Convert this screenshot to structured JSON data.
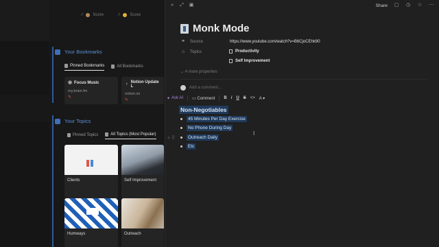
{
  "background": {
    "score_columns": [
      {
        "hash": "#",
        "label": "Score",
        "dot_color": "#b08a5a"
      },
      {
        "hash": "#",
        "label": "Score",
        "dot_color": "#e0b03a"
      }
    ],
    "bookmarks": {
      "title": "Your Bookmarks",
      "tabs": [
        {
          "label": "Pinned Bookmarks",
          "active": true
        },
        {
          "label": "All Bookmarks",
          "active": false
        }
      ],
      "cards": [
        {
          "title": "Focus Music",
          "subtitle": "my.brain.fm",
          "pin": "✎"
        },
        {
          "title": "Notion Update L",
          "subtitle": "notion.so",
          "pin": "✎"
        }
      ]
    },
    "topics": {
      "title": "Your Topics",
      "tabs": [
        {
          "label": "Pinned Topics",
          "active": false
        },
        {
          "label": "All Topics (Most Popular)",
          "active": true
        }
      ],
      "cards": [
        {
          "label": "Clients"
        },
        {
          "label": "Self Improvement"
        },
        {
          "label": "Humways"
        },
        {
          "label": "Outreach"
        }
      ]
    }
  },
  "panel": {
    "share_label": "Share",
    "page_title": "Monk Mode",
    "properties": {
      "source_label": "Source",
      "source_value": "https://www.youtube.com/watch?v=B6CjoCEhk90",
      "topics_label": "Topics",
      "topics": [
        "Productivity",
        "Self Improvement"
      ],
      "more_label": "4 more properties"
    },
    "comment_placeholder": "Add a comment...",
    "toolbar": {
      "ask_ai": "Ask AI",
      "comment": "Comment",
      "bold": "B",
      "italic": "i",
      "underline": "U",
      "strike": "S",
      "code": "<>",
      "color": "A"
    },
    "content": {
      "heading": "Non-Negotiables",
      "bullets": [
        "45 Minutes Per Day Exercise",
        "No Phone During Day",
        "Outreach Daily",
        "Etc"
      ]
    },
    "colors": {
      "highlight": "#1f3a5c",
      "accent_blue": "#5b8fd6",
      "ai_purple": "#a98bdb"
    }
  }
}
